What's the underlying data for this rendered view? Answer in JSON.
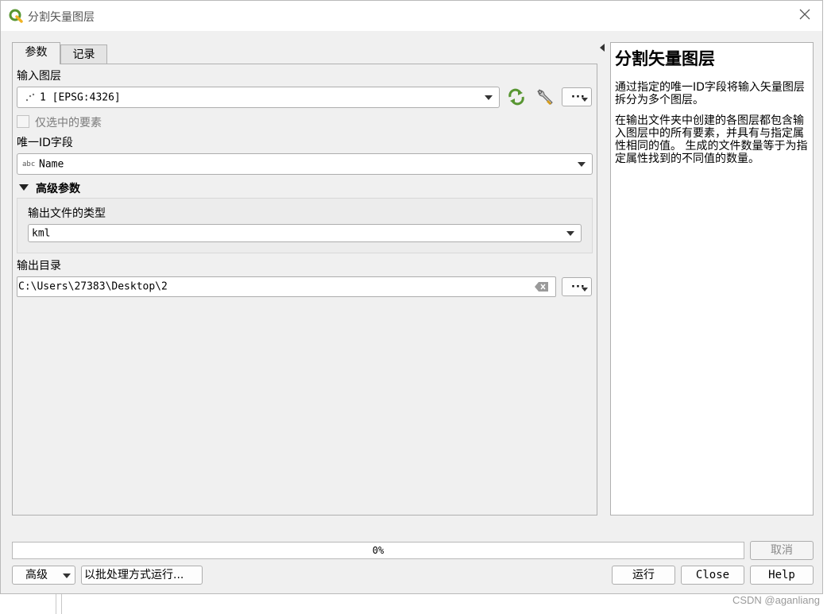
{
  "window": {
    "title": "分割矢量图层",
    "close_icon": "close-icon"
  },
  "tabs": [
    {
      "label": "参数",
      "active": true
    },
    {
      "label": "记录",
      "active": false
    }
  ],
  "params": {
    "input_layer_label": "输入图层",
    "input_layer_value": "1 [EPSG:4326]",
    "selected_only_label": "仅选中的要素",
    "selected_only_checked": false,
    "unique_id_label": "唯一ID字段",
    "unique_id_type_badge": "abc",
    "unique_id_value": "Name",
    "advanced_label": "高级参数",
    "file_type_label": "输出文件的类型",
    "file_type_value": "kml",
    "output_dir_label": "输出目录",
    "output_dir_value": "C:\\Users\\27383\\Desktop\\2",
    "dots_label": "···"
  },
  "help": {
    "title": "分割矢量图层",
    "para1": "通过指定的唯一ID字段将输入矢量图层拆分为多个图层。",
    "para2": "在输出文件夹中创建的各图层都包含输入图层中的所有要素，并具有与指定属性相同的值。 生成的文件数量等于为指定属性找到的不同值的数量。"
  },
  "footer": {
    "progress_text": "0%",
    "progress_value": 0,
    "cancel_label": "取消",
    "advanced_label": "高级",
    "batch_label": "以批处理方式运行...",
    "run_label": "运行",
    "close_label": "Close",
    "help_label": "Help"
  },
  "watermark": "CSDN @aganliang",
  "colors": {
    "accent_green": "#589632",
    "logo_yellow": "#f0b323"
  }
}
